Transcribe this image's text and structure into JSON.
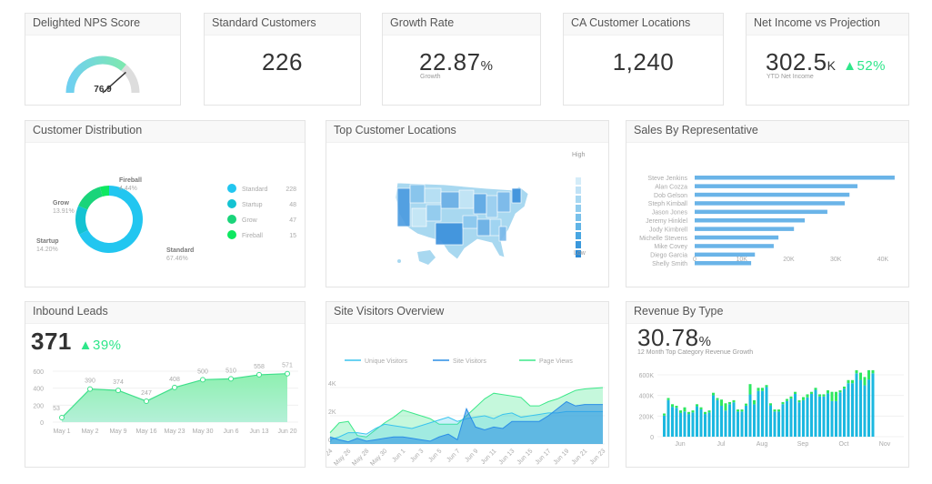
{
  "kpis": {
    "nps": {
      "title": "Delighted NPS Score",
      "value": "76.9",
      "gauge_fraction": 0.769
    },
    "standard": {
      "title": "Standard Customers",
      "value": "226"
    },
    "growth": {
      "title": "Growth Rate",
      "value": "22.87",
      "unit": "%",
      "sub": "Growth"
    },
    "ca": {
      "title": "CA Customer Locations",
      "value": "1,240"
    },
    "income": {
      "title": "Net Income vs Projection",
      "value": "302.5",
      "unit": "K",
      "change": "▲52%",
      "sub": "YTD Net Income"
    }
  },
  "colors": {
    "green": "#2ee68a",
    "blue": "#2aa8e6",
    "teal": "#13c0d8",
    "text": "#333333"
  },
  "distribution": {
    "title": "Customer Distribution",
    "slices": [
      {
        "name": "Standard",
        "pct": "67.46%",
        "value": 67.46,
        "count": "228",
        "color": "#22c6f0"
      },
      {
        "name": "Startup",
        "pct": "14.20%",
        "value": 14.2,
        "count": "48",
        "color": "#14c3d2"
      },
      {
        "name": "Grow",
        "pct": "13.91%",
        "value": 13.91,
        "count": "47",
        "color": "#1ad47a"
      },
      {
        "name": "Fireball",
        "pct": "4.44%",
        "value": 4.44,
        "count": "15",
        "color": "#0ee860"
      }
    ]
  },
  "map": {
    "title": "Top Customer Locations",
    "high": "High",
    "low": "Low"
  },
  "sales": {
    "title": "Sales By Representative",
    "xlim": [
      0,
      40000
    ],
    "ticks": [
      "0",
      "10K",
      "20K",
      "30K",
      "40K"
    ],
    "reps": [
      [
        "Steve Jenkins",
        42500
      ],
      [
        "Alan Cozza",
        34600
      ],
      [
        "Dob Gelson",
        32900
      ],
      [
        "Steph Kimball",
        31900
      ],
      [
        "Jason Jones",
        28200
      ],
      [
        "Jeremy Hinklel",
        23400
      ],
      [
        "Jody Kimbrell",
        21100
      ],
      [
        "Michelle Stevens",
        17800
      ],
      [
        "Mike Covey",
        16800
      ],
      [
        "Diego Garcia",
        12800
      ],
      [
        "Shelly Smith",
        12000
      ]
    ]
  },
  "leads": {
    "title": "Inbound Leads",
    "value": "371",
    "change": "▲39%",
    "chart_data": {
      "type": "area",
      "x": [
        "May 1",
        "May 2",
        "May 9",
        "May 16",
        "May 23",
        "May 30",
        "Jun 6",
        "Jun 13",
        "Jun 20"
      ],
      "values": [
        53,
        390,
        374,
        247,
        408,
        500,
        510,
        558,
        571
      ],
      "yticks": [
        "0",
        "200",
        "400",
        "600"
      ],
      "ylim": [
        0,
        600
      ]
    }
  },
  "visitors": {
    "title": "Site Visitors Overview",
    "chart_data": {
      "type": "area",
      "ylim": [
        0,
        4000
      ],
      "yticks": [
        "0",
        "2K",
        "4K"
      ],
      "xticks": [
        "May 24",
        "May 26",
        "May 28",
        "May 30",
        "Jun 1",
        "Jun 3",
        "Jun 5",
        "Jun 7",
        "Jun 9",
        "Jun 11",
        "Jun 13",
        "Jun 15",
        "Jun 17",
        "Jun 19",
        "Jun 21",
        "Jun 23"
      ],
      "series": [
        {
          "name": "Page Views",
          "color": "#3ee88a",
          "values": [
            800,
            1500,
            1600,
            600,
            500,
            1000,
            1500,
            1900,
            2400,
            2200,
            2000,
            1800,
            1400,
            1400,
            1400,
            2000,
            2600,
            3200,
            3600,
            3500,
            3400,
            3300,
            2700,
            2700,
            3000,
            3200,
            3500,
            3800,
            3900,
            3950,
            4000
          ]
        },
        {
          "name": "Unique Visitors",
          "color": "#38c4ee",
          "values": [
            300,
            500,
            800,
            800,
            700,
            1100,
            1400,
            1300,
            1200,
            1100,
            1300,
            1500,
            1700,
            1900,
            1600,
            1800,
            1900,
            2000,
            1800,
            2100,
            2200,
            1900,
            2000,
            2100,
            2200,
            2200,
            2300,
            2300,
            2300,
            2300,
            2300
          ]
        },
        {
          "name": "Site Visitors",
          "color": "#2a8ee6",
          "values": [
            500,
            300,
            150,
            400,
            200,
            300,
            400,
            500,
            500,
            400,
            300,
            200,
            500,
            700,
            300,
            2500,
            1200,
            1000,
            1200,
            1100,
            1600,
            1600,
            1600,
            1600,
            2000,
            2500,
            3000,
            2700,
            2800,
            2800,
            2800
          ]
        }
      ]
    }
  },
  "revenue": {
    "title": "Revenue By Type",
    "value": "30.78",
    "unit": "%",
    "sub": "12 Month Top Category Revenue Growth",
    "chart_data": {
      "type": "bar",
      "stacked": true,
      "ylim": [
        0,
        600000
      ],
      "yticks": [
        "0",
        "200K",
        "400K",
        "600K"
      ],
      "xticks": [
        "Jun",
        "Jul",
        "Aug",
        "Sep",
        "Oct",
        "Nov"
      ],
      "totals": [
        225,
        375,
        315,
        300,
        255,
        285,
        240,
        255,
        315,
        285,
        240,
        255,
        426,
        375,
        360,
        324,
        336,
        354,
        264,
        264,
        321,
        510,
        354,
        474,
        474,
        501,
        324,
        264,
        264,
        336,
        366,
        390,
        435,
        354,
        384,
        411,
        435,
        474,
        411,
        411,
        450,
        435,
        435,
        450,
        486,
        549,
        549,
        645,
        621,
        579,
        645,
        645
      ],
      "green": [
        20,
        20,
        25,
        20,
        25,
        40,
        20,
        20,
        20,
        20,
        20,
        20,
        25,
        20,
        60,
        70,
        20,
        20,
        20,
        20,
        20,
        100,
        40,
        30,
        30,
        20,
        20,
        20,
        20,
        20,
        20,
        20,
        20,
        20,
        30,
        30,
        20,
        20,
        20,
        20,
        30,
        90,
        90,
        20,
        20,
        30,
        30,
        30,
        70,
        80,
        90,
        30
      ]
    }
  }
}
